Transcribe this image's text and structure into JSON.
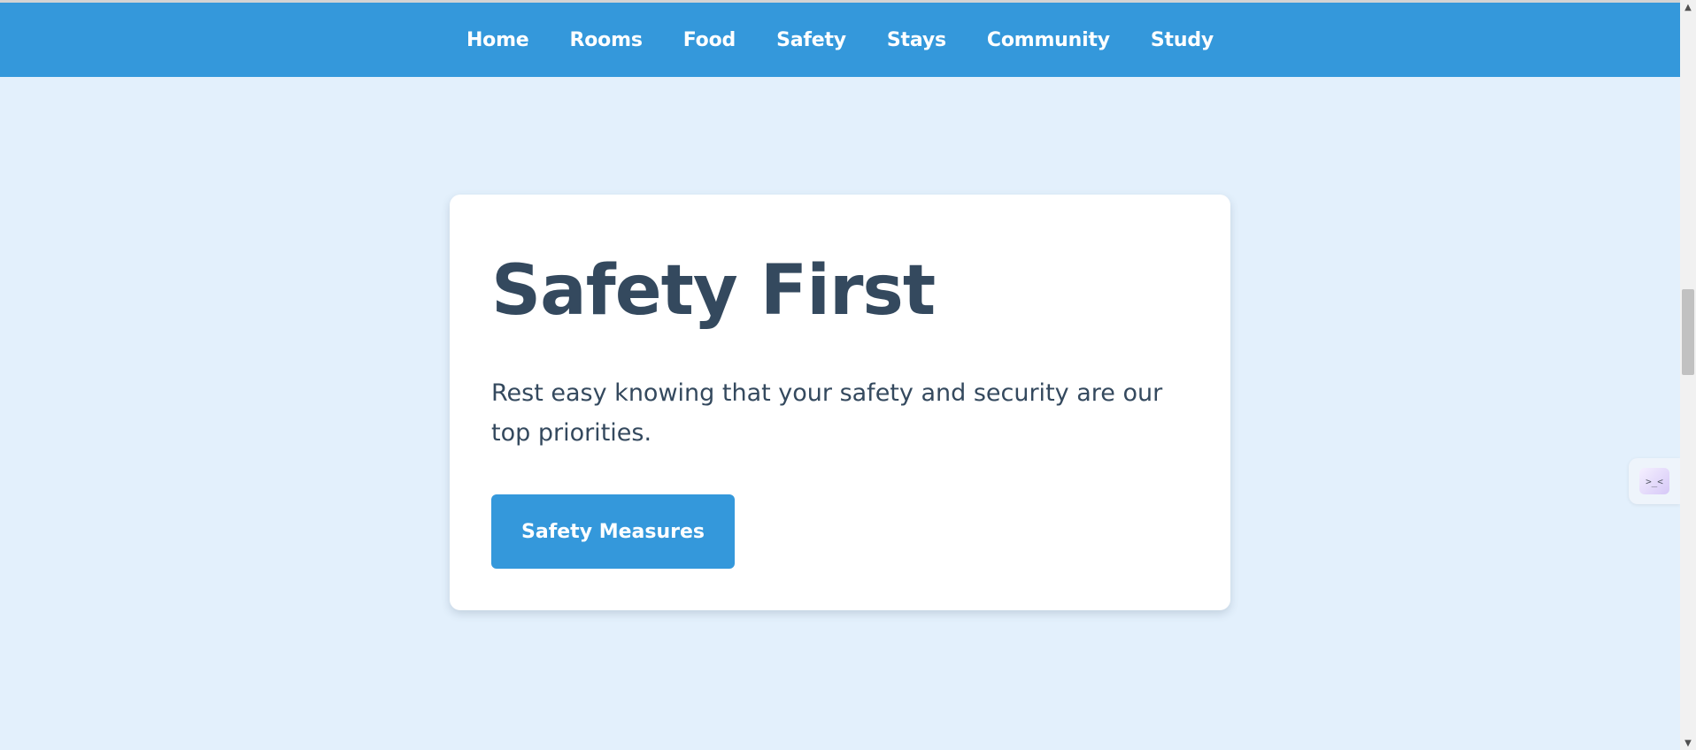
{
  "nav": {
    "items": [
      {
        "label": "Home"
      },
      {
        "label": "Rooms"
      },
      {
        "label": "Food"
      },
      {
        "label": "Safety"
      },
      {
        "label": "Stays"
      },
      {
        "label": "Community"
      },
      {
        "label": "Study"
      }
    ]
  },
  "hero": {
    "title": "Safety First",
    "text": "Rest easy knowing that your safety and security are our top priorities.",
    "button_label": "Safety Measures"
  },
  "widget": {
    "glyph": ">_<",
    "icon": "assistant-face-icon"
  },
  "scrollbar": {
    "up_glyph": "▲",
    "down_glyph": "▼"
  },
  "colors": {
    "nav_bg": "#3498db",
    "page_bg": "#e3f0fc",
    "card_bg": "#ffffff",
    "heading": "#34495e",
    "button_bg": "#3498db"
  }
}
